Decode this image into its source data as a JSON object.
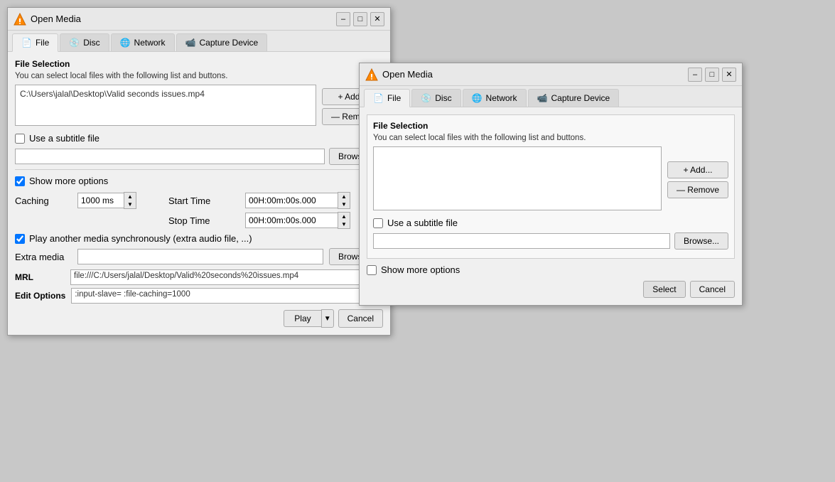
{
  "window1": {
    "title": "Open Media",
    "tabs": [
      {
        "id": "file",
        "label": "File",
        "icon": "📄",
        "active": true
      },
      {
        "id": "disc",
        "label": "Disc",
        "icon": "💿"
      },
      {
        "id": "network",
        "label": "Network",
        "icon": "🌐"
      },
      {
        "id": "capture",
        "label": "Capture Device",
        "icon": "📹"
      }
    ],
    "file_selection": {
      "header": "File Selection",
      "desc": "You can select local files with the following list and buttons.",
      "file_path": "C:\\Users\\jalal\\Desktop\\Valid seconds issues.mp4",
      "add_label": "+ Add...",
      "remove_label": "— Remove"
    },
    "subtitle": {
      "checkbox_label": "Use a subtitle file",
      "browse_label": "Browse..."
    },
    "show_more": {
      "checked": true,
      "label": "Show more options"
    },
    "options": {
      "caching_label": "Caching",
      "caching_value": "1000 ms",
      "start_time_label": "Start Time",
      "start_time_value": "00H:00m:00s.000",
      "stop_time_label": "Stop Time",
      "stop_time_value": "00H:00m:00s.000"
    },
    "sync": {
      "checked": true,
      "label": "Play another media synchronously (extra audio file, ...)"
    },
    "extra_media": {
      "label": "Extra media",
      "browse_label": "Browse..."
    },
    "mrl": {
      "label": "MRL",
      "value": "file:///C:/Users/jalal/Desktop/Valid%20seconds%20issues.mp4"
    },
    "edit_options": {
      "label": "Edit Options",
      "value": ":input-slave= :file-caching=1000"
    },
    "buttons": {
      "play_label": "Play",
      "cancel_label": "Cancel"
    }
  },
  "window2": {
    "title": "Open Media",
    "tabs": [
      {
        "id": "file",
        "label": "File",
        "icon": "📄",
        "active": true
      },
      {
        "id": "disc",
        "label": "Disc",
        "icon": "💿"
      },
      {
        "id": "network",
        "label": "Network",
        "icon": "🌐"
      },
      {
        "id": "capture",
        "label": "Capture Device",
        "icon": "📹"
      }
    ],
    "file_selection": {
      "header": "File Selection",
      "desc": "You can select local files with the following list and buttons.",
      "add_label": "+ Add...",
      "remove_label": "— Remove"
    },
    "subtitle": {
      "checkbox_label": "Use a subtitle file",
      "browse_label": "Browse..."
    },
    "show_more": {
      "checked": false,
      "label": "Show more options"
    },
    "buttons": {
      "select_label": "Select",
      "cancel_label": "Cancel"
    }
  }
}
